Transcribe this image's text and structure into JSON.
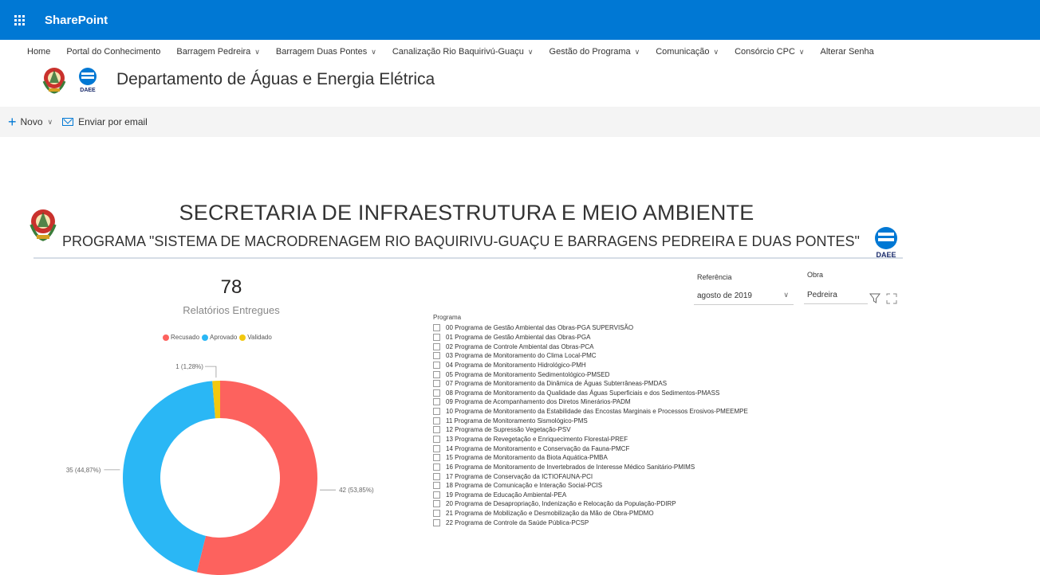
{
  "suitebar": {
    "app_name": "SharePoint",
    "color": "#0078d4"
  },
  "nav": {
    "items": [
      {
        "label": "Home",
        "dropdown": false
      },
      {
        "label": "Portal do Conhecimento",
        "dropdown": false
      },
      {
        "label": "Barragem Pedreira",
        "dropdown": true
      },
      {
        "label": "Barragem Duas Pontes",
        "dropdown": true
      },
      {
        "label": "Canalização Rio Baquirivú-Guaçu",
        "dropdown": true
      },
      {
        "label": "Gestão do Programa",
        "dropdown": true
      },
      {
        "label": "Comunicação",
        "dropdown": true
      },
      {
        "label": "Consórcio CPC",
        "dropdown": true
      },
      {
        "label": "Alterar Senha",
        "dropdown": false
      }
    ]
  },
  "site": {
    "title": "Departamento de Águas e Energia Elétrica",
    "logo_text": "DAEE"
  },
  "command_bar": {
    "new_label": "Novo",
    "email_label": "Enviar por email"
  },
  "report": {
    "title": "SECRETARIA DE INFRAESTRUTURA E MEIO AMBIENTE",
    "subtitle": "PROGRAMA \"SISTEMA DE MACRODRENAGEM RIO BAQUIRIVU-GUAÇU E BARRAGENS PEDREIRA E DUAS PONTES\"",
    "kpi_value": "78",
    "kpi_label": "Relatórios Entregues",
    "filters": {
      "referencia_label": "Referência",
      "referencia_value": "agosto de 2019",
      "obra_label": "Obra",
      "obra_value": "Pedreira"
    },
    "programs_header": "Programa",
    "programs": [
      "00 Programa de Gestão Ambiental das Obras-PGA SUPERVISÃO",
      "01 Programa de Gestão Ambiental das Obras-PGA",
      "02 Programa de Controle Ambiental das Obras-PCA",
      "03 Programa de Monitoramento do Clima Local-PMC",
      "04 Programa de Monitoramento Hidrológico-PMH",
      "05 Programa de Monitoramento Sedimentológico-PMSED",
      "07 Programa de Monitoramento da Dinâmica de Águas Subterrâneas-PMDAS",
      "08 Programa de Monitoramento da Qualidade das Águas Superficiais e dos Sedimentos-PMASS",
      "09 Programa de Acompanhamento dos Diretos Minerários-PADM",
      "10 Programa de Monitoramento da Estabilidade das Encostas Marginais e Processos Erosivos-PMEEMPE",
      "11 Programa de Monitoramento Sismológico-PMS",
      "12 Programa de Supressão Vegetação-PSV",
      "13 Programa de Revegetação e Enriquecimento Florestal-PREF",
      "14 Programa de Monitoramento e Conservação da Fauna-PMCF",
      "15 Programa de Monitoramento da Biota Aquática-PMBA",
      "16 Programa de Monitoramento de Invertebrados de Interesse Médico Sanitário-PMIMS",
      "17 Programa de Conservação da ICTIOFAUNA-PCI",
      "18 Programa de Comunicação e Interação Social-PCIS",
      "19 Programa de Educação Ambiental-PEA",
      "20 Programa de Desapropriação, Indenização e Relocação da População-PDIRP",
      "21 Programa de Mobilização e Desmobilização da Mão de Obra-PMDMO",
      "22 Programa de Controle da Saúde Pública-PCSP"
    ]
  },
  "chart_data": {
    "type": "pie",
    "donut": true,
    "categories": [
      "Recusado",
      "Aprovado",
      "Validado"
    ],
    "values": [
      42,
      35,
      1
    ],
    "labels": [
      "42 (53,85%)",
      "35 (44,87%)",
      "1 (1,28%)"
    ],
    "colors": [
      "#fd625e",
      "#01b8aa",
      "#f2c80f"
    ],
    "legend_position": "top"
  },
  "colors": {
    "recusado": "#fd625e",
    "aprovado": "#2ab7f5",
    "validado": "#f2c80f",
    "accent": "#0078d4"
  }
}
